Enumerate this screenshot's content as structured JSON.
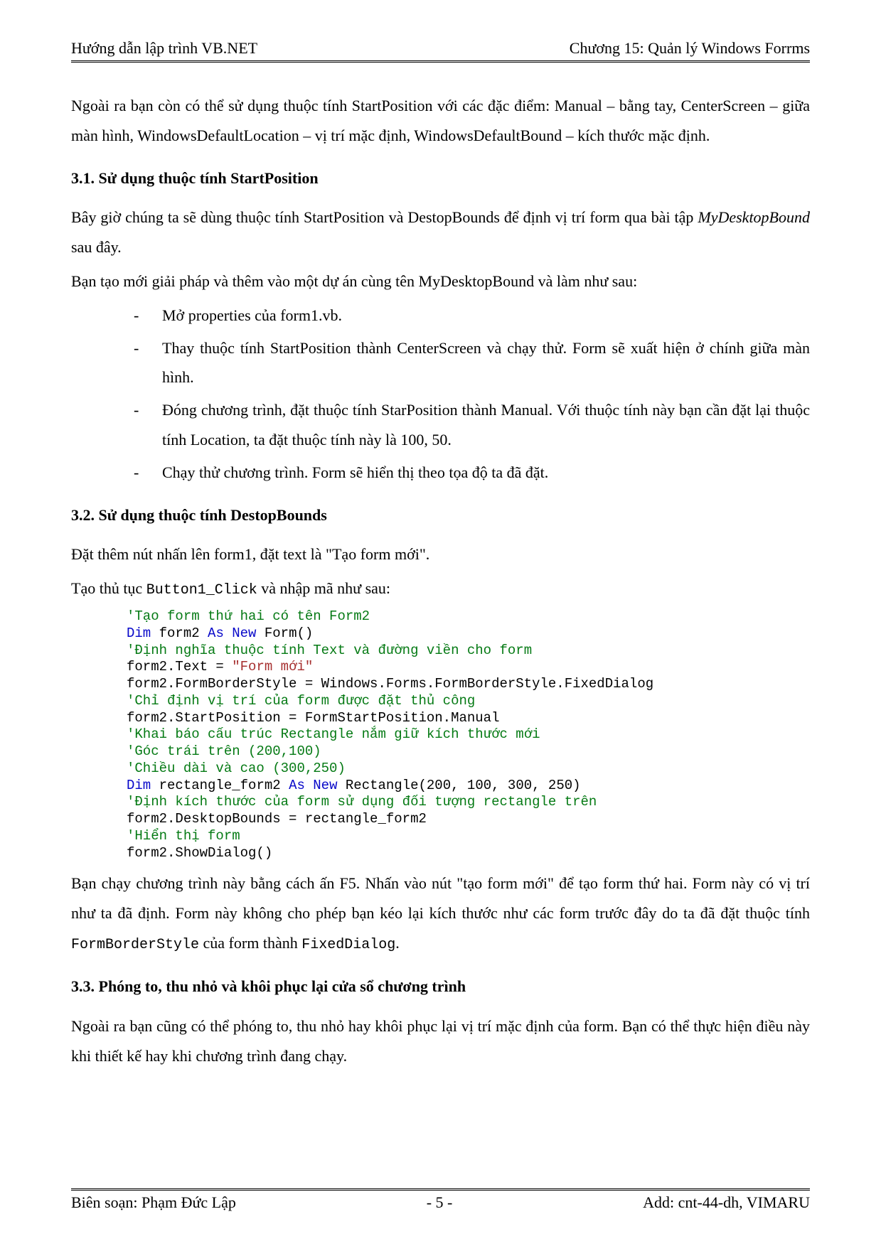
{
  "header": {
    "left": "Hướng dẫn lập trình VB.NET",
    "right": "Chương 15: Quản lý Windows Forrms"
  },
  "intro": "Ngoài ra bạn còn có thể sử dụng thuộc tính StartPosition với các đặc điểm: Manual – bằng tay, CenterScreen – giữa màn hình, WindowsDefaultLocation – vị trí mặc định, WindowsDefaultBound – kích thước mặc định.",
  "sec31": {
    "title": "3.1. Sử dụng thuộc tính StartPosition",
    "p1a": "Bây giờ chúng ta sẽ dùng thuộc tính StartPosition và DestopBounds để định vị trí form qua bài tập ",
    "p1i": "MyDesktopBound",
    "p1b": " sau đây.",
    "p2": "Bạn tạo mới giải pháp và thêm vào một dự án cùng tên MyDesktopBound và làm như sau:",
    "bullets": [
      "Mở properties của form1.vb.",
      "Thay thuộc tính StartPosition thành CenterScreen và chạy thử. Form sẽ xuất hiện ở chính giữa màn hình.",
      "Đóng chương trình, đặt thuộc tính StarPosition thành Manual. Với thuộc tính này bạn cần đặt lại thuộc tính Location, ta đặt thuộc tính này là 100, 50.",
      "Chạy thử chương trình. Form sẽ hiển thị theo tọa độ ta đã đặt."
    ]
  },
  "sec32": {
    "title": "3.2. Sử dụng thuộc tính DestopBounds",
    "p1": "Đặt thêm nút nhấn lên form1, đặt text là \"Tạo form mới\".",
    "p2a": "Tạo thủ tục ",
    "p2m": "Button1_Click",
    "p2b": " và nhập mã như sau:",
    "code": {
      "l1": "'Tạo form thứ hai có tên Form2",
      "l2a": "Dim",
      "l2b": " form2 ",
      "l2c": "As New",
      "l2d": " Form()",
      "l3": "'Định nghĩa thuộc tính Text và đường viền cho form",
      "l4a": "form2.Text = ",
      "l4b": "\"Form mới\"",
      "l5": "form2.FormBorderStyle = Windows.Forms.FormBorderStyle.FixedDialog",
      "l6": "'Chỉ định vị trí của form được đặt thủ công",
      "l7": "form2.StartPosition = FormStartPosition.Manual",
      "l8": "'Khai báo cấu trúc Rectangle nắm giữ kích thước mới",
      "l9": "'Góc trái trên (200,100)",
      "l10": "'Chiều dài và cao (300,250)",
      "l11a": "Dim",
      "l11b": " rectangle_form2 ",
      "l11c": "As New",
      "l11d": " Rectangle(200, 100, 300, 250)",
      "l12": "'Định kích thước của form sử dụng đối tượng rectangle trên",
      "l13": "form2.DesktopBounds = rectangle_form2",
      "l14": "'Hiển thị form",
      "l15": "form2.ShowDialog()"
    },
    "p3a": "Bạn chạy chương trình này bằng cách ấn F5. Nhấn vào nút \"tạo form mới\" để tạo form thứ hai. Form này có vị trí như ta đã định. Form này không cho phép bạn kéo lại kích thước như các form trước đây do ta đã đặt thuộc tính ",
    "p3m1": "FormBorderStyle",
    "p3b": " của form thành ",
    "p3m2": "FixedDialog",
    "p3c": "."
  },
  "sec33": {
    "title": "3.3. Phóng to, thu nhỏ và khôi phục lại cửa sổ chương trình",
    "p1": "Ngoài ra bạn cũng có thể phóng to, thu nhỏ hay khôi phục lại vị trí mặc định của form. Bạn có thể thực hiện điều này khi thiết kế hay khi chương trình đang chạy."
  },
  "footer": {
    "left": "Biên soạn: Phạm Đức Lập",
    "center": "- 5 -",
    "right": "Add: cnt-44-dh, VIMARU"
  }
}
